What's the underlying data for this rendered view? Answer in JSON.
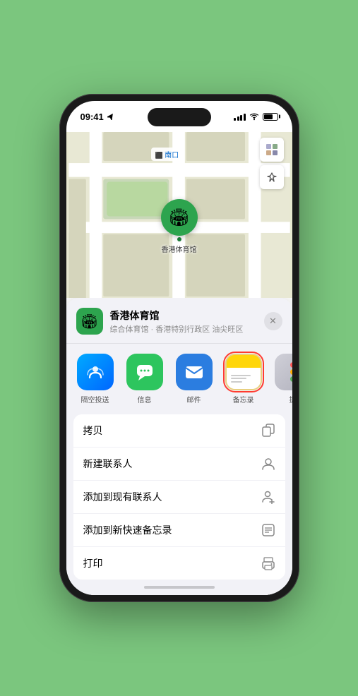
{
  "statusBar": {
    "time": "09:41",
    "locationArrow": "▶"
  },
  "mapLabel": "南口",
  "venuePinEmoji": "🏟",
  "venuePinLabel": "香港体育馆",
  "controls": {
    "mapIcon": "🗺",
    "locationIcon": "➤"
  },
  "venueInfo": {
    "name": "香港体育馆",
    "desc": "综合体育馆 · 香港特别行政区 油尖旺区",
    "icon": "🏟"
  },
  "shareIcons": [
    {
      "id": "airdrop",
      "label": "隔空投送",
      "type": "airdrop"
    },
    {
      "id": "message",
      "label": "信息",
      "type": "message"
    },
    {
      "id": "mail",
      "label": "邮件",
      "type": "mail"
    },
    {
      "id": "notes",
      "label": "备忘录",
      "type": "notes"
    },
    {
      "id": "more",
      "label": "提",
      "type": "more"
    }
  ],
  "actionItems": [
    {
      "label": "拷贝",
      "icon": "copy"
    },
    {
      "label": "新建联系人",
      "icon": "person"
    },
    {
      "label": "添加到现有联系人",
      "icon": "person-add"
    },
    {
      "label": "添加到新快速备忘录",
      "icon": "quicknote"
    },
    {
      "label": "打印",
      "icon": "print"
    }
  ]
}
